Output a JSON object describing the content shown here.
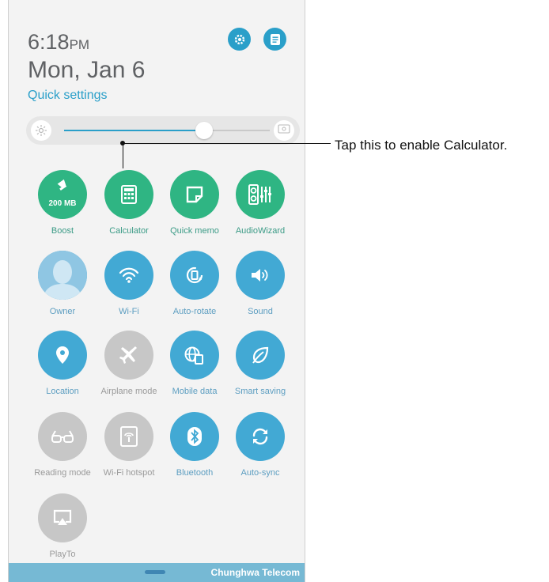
{
  "header": {
    "time": "6:18",
    "ampm": "PM",
    "date": "Mon, Jan 6",
    "quick_settings_label": "Quick settings"
  },
  "brightness": {
    "level": 0.68,
    "auto_label": "AUTO"
  },
  "tiles": [
    {
      "label": "Boost",
      "icon": "broom-icon",
      "state": "on",
      "badge": "200 MB",
      "color": "#2fb583"
    },
    {
      "label": "Calculator",
      "icon": "calculator-icon",
      "state": "on",
      "color": "#2fb583"
    },
    {
      "label": "Quick memo",
      "icon": "memo-icon",
      "state": "on",
      "color": "#2fb583"
    },
    {
      "label": "AudioWizard",
      "icon": "audio-wizard-icon",
      "state": "on",
      "color": "#2fb583"
    },
    {
      "label": "Owner",
      "icon": "avatar-icon",
      "state": "on",
      "color": "#42a9d4"
    },
    {
      "label": "Wi-Fi",
      "icon": "wifi-icon",
      "state": "on",
      "color": "#42a9d4"
    },
    {
      "label": "Auto-rotate",
      "icon": "rotate-icon",
      "state": "on",
      "color": "#42a9d4"
    },
    {
      "label": "Sound",
      "icon": "speaker-icon",
      "state": "on",
      "color": "#42a9d4"
    },
    {
      "label": "Location",
      "icon": "location-pin-icon",
      "state": "on",
      "color": "#42a9d4"
    },
    {
      "label": "Airplane mode",
      "icon": "airplane-icon",
      "state": "off",
      "color": "#c7c7c7"
    },
    {
      "label": "Mobile data",
      "icon": "mobile-data-icon",
      "state": "on",
      "color": "#42a9d4"
    },
    {
      "label": "Smart saving",
      "icon": "leaf-icon",
      "state": "on",
      "color": "#42a9d4"
    },
    {
      "label": "Reading mode",
      "icon": "glasses-icon",
      "state": "off",
      "color": "#c7c7c7"
    },
    {
      "label": "Wi-Fi hotspot",
      "icon": "hotspot-icon",
      "state": "off",
      "color": "#c7c7c7"
    },
    {
      "label": "Bluetooth",
      "icon": "bluetooth-icon",
      "state": "on",
      "color": "#42a9d4"
    },
    {
      "label": "Auto-sync",
      "icon": "sync-icon",
      "state": "on",
      "color": "#42a9d4"
    },
    {
      "label": "PlayTo",
      "icon": "cast-icon",
      "state": "off",
      "color": "#c7c7c7"
    }
  ],
  "footer": {
    "carrier": "Chunghwa Telecom"
  },
  "callout": {
    "text": "Tap this to enable Calculator."
  },
  "colors": {
    "accent": "#2a9fc9",
    "green": "#2fb583",
    "blue": "#42a9d4",
    "disabled": "#c7c7c7"
  }
}
